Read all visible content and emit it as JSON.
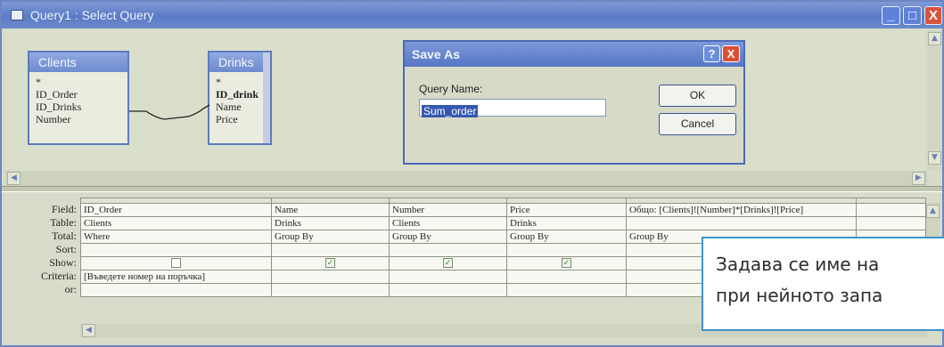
{
  "window": {
    "title": "Query1 : Select Query",
    "minimize": "_",
    "maximize": "□",
    "close": "X"
  },
  "tables": [
    {
      "name": "Clients",
      "fields": [
        "*",
        "ID_Order",
        "ID_Drinks",
        "Number"
      ]
    },
    {
      "name": "Drinks",
      "fields": [
        "*",
        "ID_drink",
        "Name",
        "Price"
      ]
    }
  ],
  "dialog": {
    "title": "Save As",
    "help": "?",
    "close": "X",
    "label": "Query Name:",
    "value": "Sum_order",
    "ok": "OK",
    "cancel": "Cancel"
  },
  "grid": {
    "row_labels": [
      "Field:",
      "Table:",
      "Total:",
      "Sort:",
      "Show:",
      "Criteria:",
      "or:"
    ],
    "columns": [
      {
        "field": "ID_Order",
        "table": "Clients",
        "total": "Where",
        "sort": "",
        "show": false,
        "criteria": "[Въведете номер на поръчка]",
        "or": ""
      },
      {
        "field": "Name",
        "table": "Drinks",
        "total": "Group By",
        "sort": "",
        "show": true,
        "criteria": "",
        "or": ""
      },
      {
        "field": "Number",
        "table": "Clients",
        "total": "Group By",
        "sort": "",
        "show": true,
        "criteria": "",
        "or": ""
      },
      {
        "field": "Price",
        "table": "Drinks",
        "total": "Group By",
        "sort": "",
        "show": true,
        "criteria": "",
        "or": ""
      },
      {
        "field": "Общо: [Clients]![Number]*[Drinks]![Price]",
        "table": "",
        "total": "Group By",
        "sort": "",
        "show": true,
        "criteria": "",
        "or": ""
      }
    ]
  },
  "callout": {
    "line1": "Задава се име на",
    "line2": "при нейното запа"
  },
  "colors": {
    "titlebar": "#6a88cc",
    "close": "#d8543d",
    "callout_border": "#3f93c9"
  }
}
